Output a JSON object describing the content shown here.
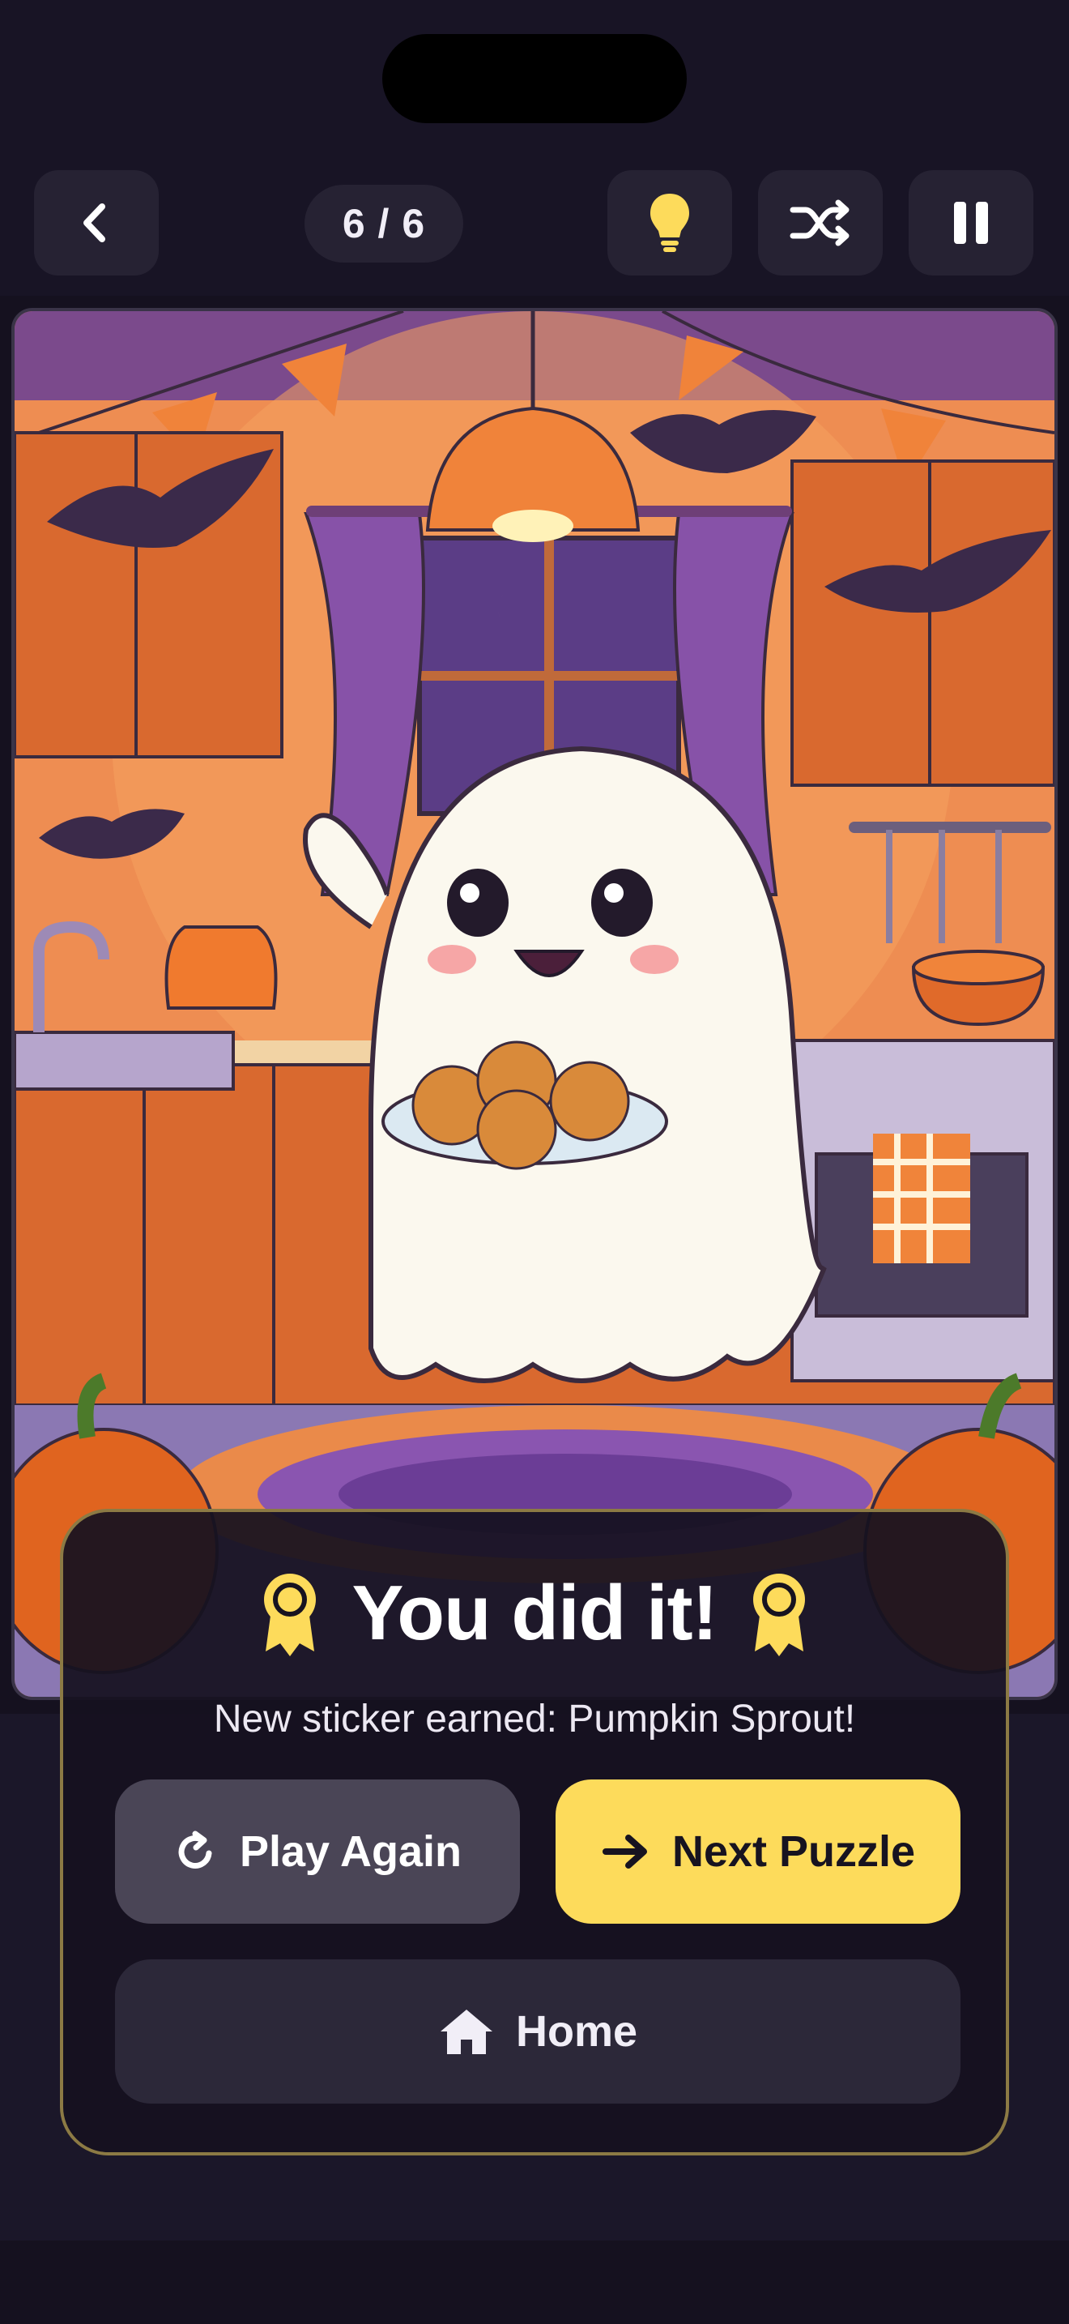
{
  "header": {
    "counter": "6 / 6",
    "back_icon": "chevron-left-icon",
    "hint_icon": "lightbulb-icon",
    "shuffle_icon": "shuffle-icon",
    "pause_icon": "pause-icon"
  },
  "puzzle": {
    "image": "ghost-kitchen-halloween-illustration"
  },
  "modal": {
    "title": "You did it!",
    "subtitle": "New sticker earned: Pumpkin Sprout!",
    "badge_icon": "award-ribbon-icon",
    "play_again_label": "Play Again",
    "next_label": "Next Puzzle",
    "home_label": "Home"
  },
  "colors": {
    "accent": "#fddb5b",
    "background": "#15111f",
    "surface": "#262233",
    "modal_border": "#8c7a44"
  }
}
